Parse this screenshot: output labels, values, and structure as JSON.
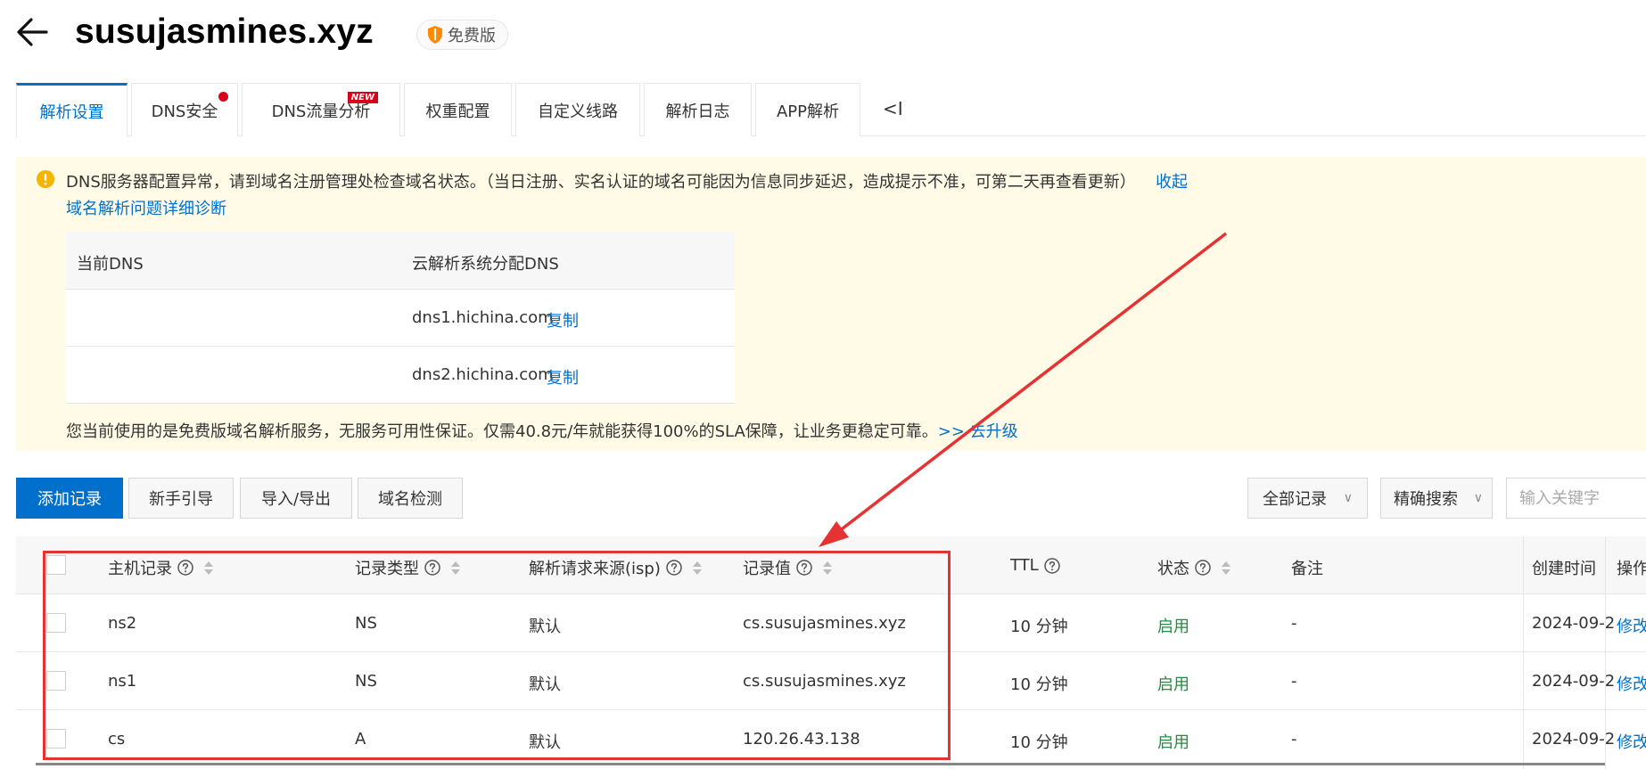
{
  "header": {
    "domain": "susujasmines.xyz",
    "edition_badge": "免费版"
  },
  "tabs": [
    {
      "label": "解析设置",
      "active": true
    },
    {
      "label": "DNS安全",
      "dot": true
    },
    {
      "label": "DNS流量分析",
      "tag": "NEW"
    },
    {
      "label": "权重配置"
    },
    {
      "label": "自定义线路"
    },
    {
      "label": "解析日志"
    },
    {
      "label": "APP解析"
    }
  ],
  "tabs_collapse": "<I",
  "notice": {
    "message": "DNS服务器配置异常，请到域名注册管理处检查域名状态。（当日注册、实名认证的域名可能因为信息同步延迟，造成提示不准，可第二天再查看更新）",
    "collapse": "收起",
    "diagnose": "域名解析问题详细诊断",
    "dns_table": {
      "col_current": "当前DNS",
      "col_assigned": "云解析系统分配DNS",
      "rows": [
        {
          "current": "",
          "assigned": "dns1.hichina.com",
          "copy": "复制"
        },
        {
          "current": "",
          "assigned": "dns2.hichina.com",
          "copy": "复制"
        }
      ]
    },
    "upgrade_text": "您当前使用的是免费版域名解析服务，无服务可用性保证。仅需40.8元/年就能获得100%的SLA保障，让业务更稳定可靠。",
    "upgrade_link": ">> 去升级"
  },
  "toolbar": {
    "add_record": "添加记录",
    "guide": "新手引导",
    "import_export": "导入/导出",
    "domain_check": "域名检测",
    "filter_records": "全部记录",
    "search_mode": "精确搜索",
    "search_placeholder": "输入关键字"
  },
  "records_table": {
    "columns": {
      "host": "主机记录",
      "type": "记录类型",
      "isp": "解析请求来源(isp)",
      "value": "记录值",
      "ttl": "TTL",
      "status": "状态",
      "remark": "备注",
      "created": "创建时间",
      "actions": "操作"
    },
    "rows": [
      {
        "host": "ns2",
        "type": "NS",
        "isp": "默认",
        "value": "cs.susujasmines.xyz",
        "ttl": "10 分钟",
        "status": "启用",
        "remark": "-",
        "created": "2024-09-2",
        "action": "修改"
      },
      {
        "host": "ns1",
        "type": "NS",
        "isp": "默认",
        "value": "cs.susujasmines.xyz",
        "ttl": "10 分钟",
        "status": "启用",
        "remark": "-",
        "created": "2024-09-2",
        "action": "修改"
      },
      {
        "host": "cs",
        "type": "A",
        "isp": "默认",
        "value": "120.26.43.138",
        "ttl": "10 分钟",
        "status": "启用",
        "remark": "-",
        "created": "2024-09-2",
        "action": "修改"
      }
    ]
  },
  "colors": {
    "accent": "#0070cc",
    "notice_bg": "#fffbe6",
    "enabled": "#1e8e3e",
    "annotation": "#e53333",
    "alert_dot": "#d9001b"
  }
}
